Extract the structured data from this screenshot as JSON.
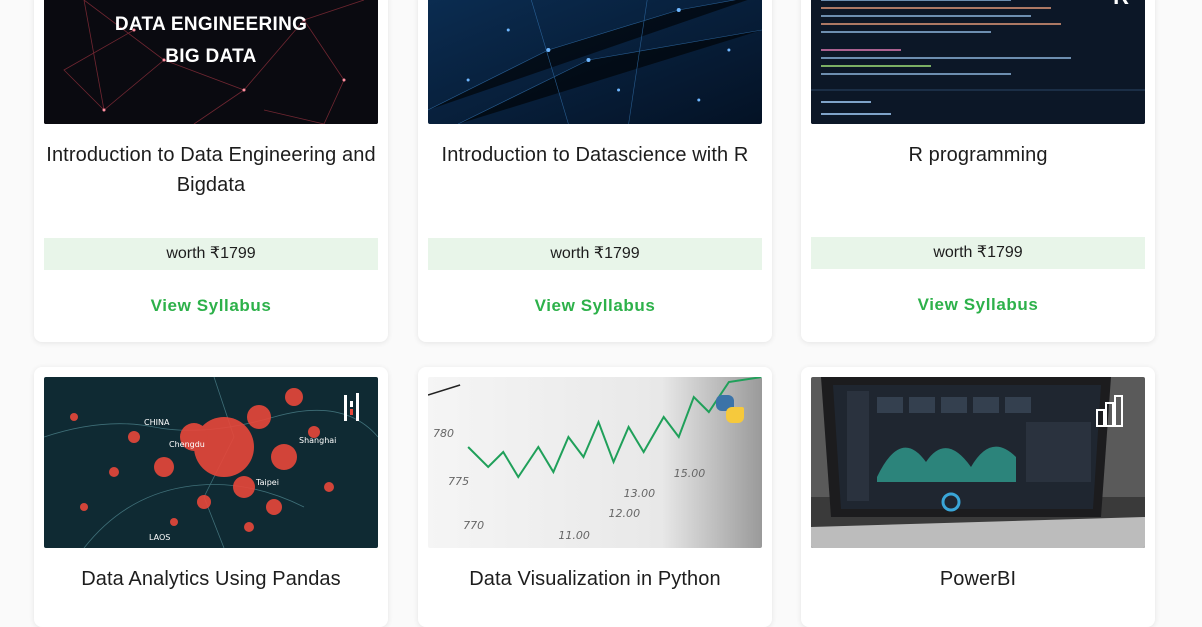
{
  "courses": [
    {
      "title": "Introduction to Data Engineering and Bigdata",
      "worth": "worth ₹1799",
      "link": "View Syllabus",
      "thumb_text_1": "DATA ENGINEERING",
      "thumb_text_2": "BIG DATA"
    },
    {
      "title": "Introduction to Datascience with R",
      "worth": "worth ₹1799",
      "link": "View Syllabus"
    },
    {
      "title": "R programming",
      "worth": "worth ₹1799",
      "link": "View Syllabus",
      "thumb_badge": "R"
    },
    {
      "title": "Data Analytics Using Pandas",
      "thumb_map_labels": [
        "CHINA",
        "Chengdu",
        "Shanghai",
        "LAOS",
        "Taipei"
      ],
      "icon": "pandas-logo-icon"
    },
    {
      "title": "Data Visualization in Python",
      "thumb_axis_labels": [
        "780",
        "775",
        "770",
        "11.00",
        "12.00",
        "13.00",
        "15.00"
      ],
      "icon": "python-logo-icon"
    },
    {
      "title": "PowerBI",
      "icon": "powerbi-logo-icon"
    }
  ],
  "colors": {
    "accent_green": "#2db14a",
    "worth_bg": "#e8f5e9",
    "text": "#1d1d1d"
  }
}
